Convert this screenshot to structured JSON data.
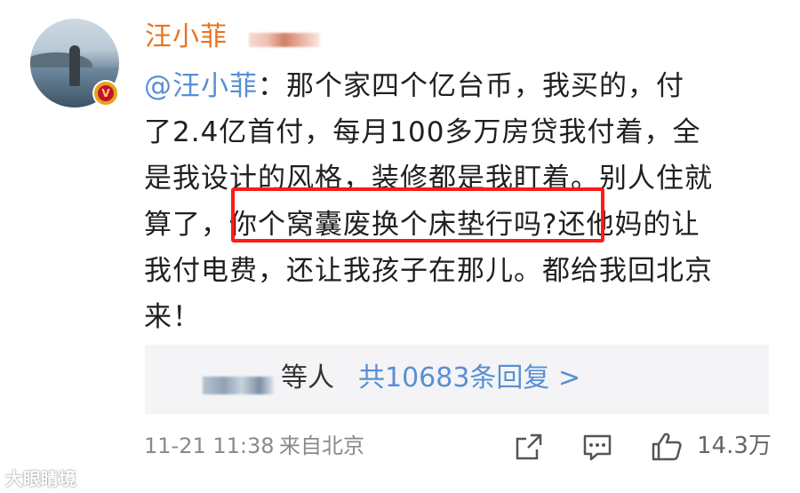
{
  "post": {
    "username": "汪小菲",
    "content": {
      "mention": "@汪小菲",
      "line1_rest": "：那个家四个亿台币，我买的，付",
      "line2": "了2.4亿首付，每月100多万房贷我付着，全",
      "line3": "是我设计的风格，装修都是我盯着。别人住就",
      "line4_start": "算了，",
      "line4_highlight": "你个窝囊废换个床垫行吗?",
      "line4_end": "还他妈的让",
      "line5": "我付电费，还让我孩子在那儿。都给我回北京",
      "line6": "来！"
    }
  },
  "replies": {
    "who": "等人",
    "count_text": "共10683条回复 >"
  },
  "meta": {
    "time": "11-21 11:38",
    "source": "来自北京",
    "likes": "14.3万"
  },
  "watermark": "大眼睛境",
  "colors": {
    "username": "#e8731e",
    "link": "#5a8fd3",
    "highlight_border": "#ff1a1a"
  }
}
